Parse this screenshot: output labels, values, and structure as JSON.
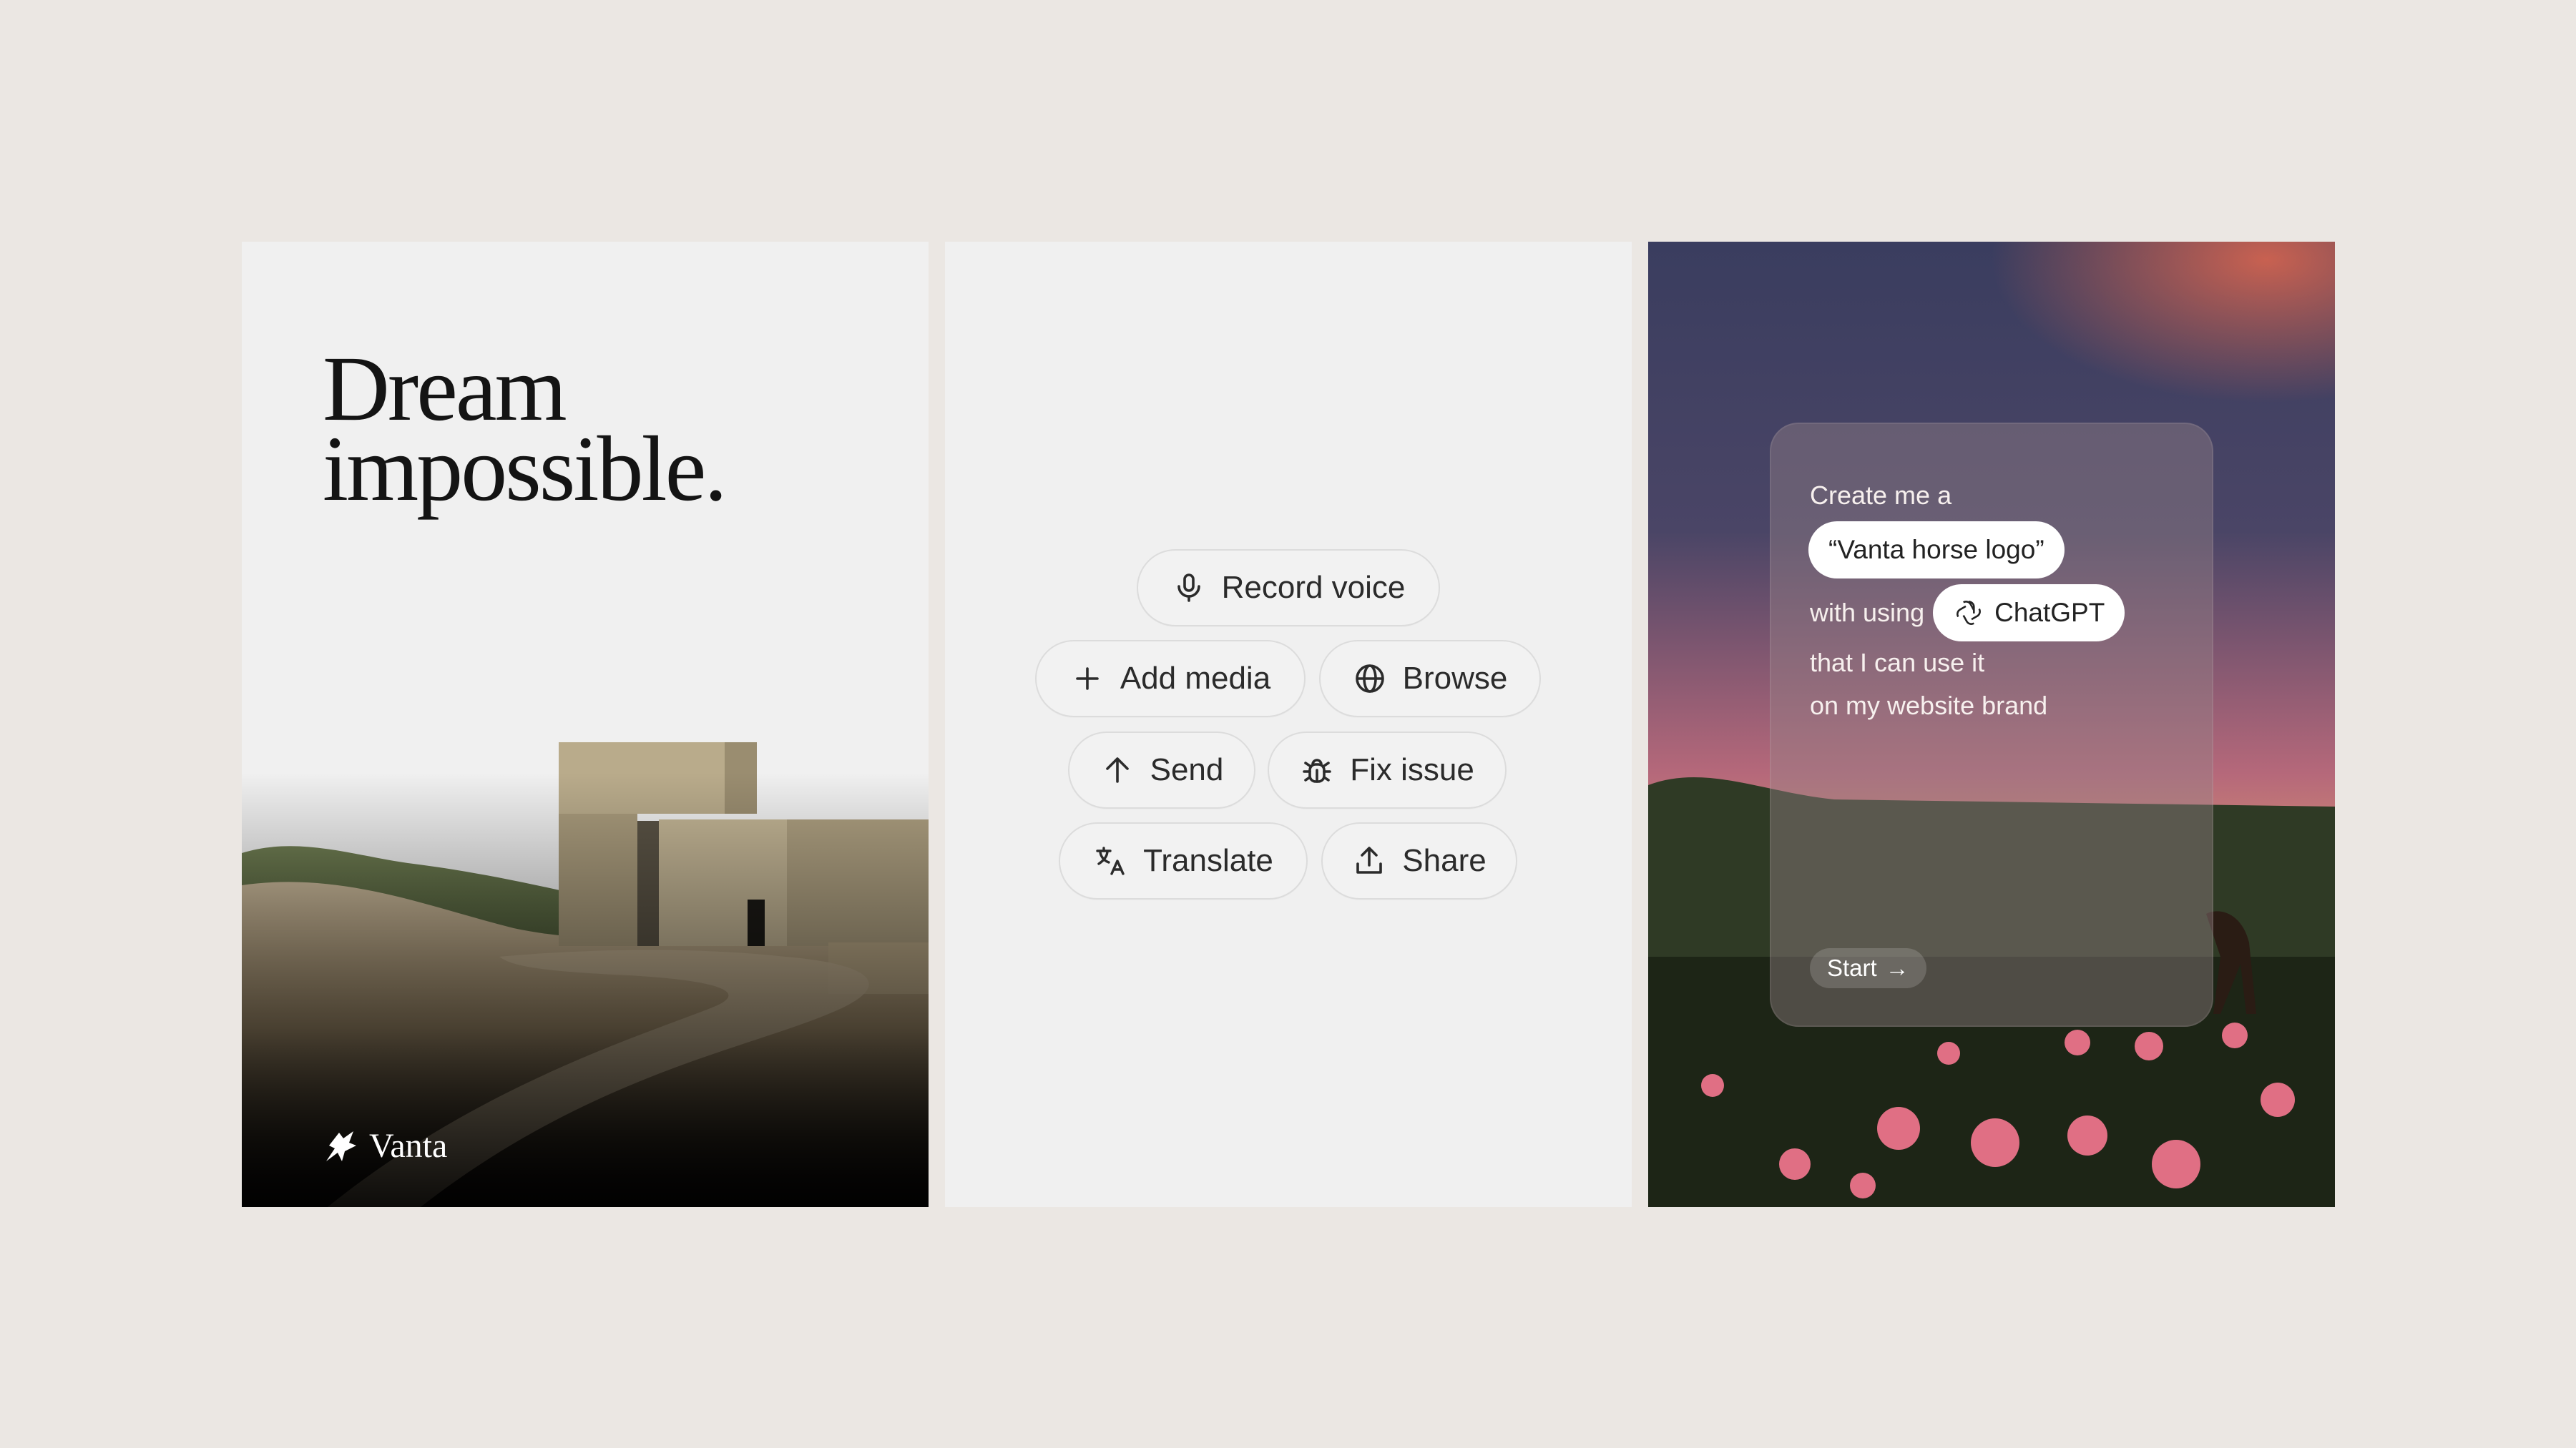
{
  "poster": {
    "headline": "Dream\nimpossible.",
    "brand_name": "Vanta"
  },
  "actions": [
    {
      "label": "Record voice",
      "icon": "microphone-icon"
    },
    {
      "label": "Add media",
      "icon": "plus-icon"
    },
    {
      "label": "Browse",
      "icon": "globe-icon"
    },
    {
      "label": "Send",
      "icon": "arrow-up-icon"
    },
    {
      "label": "Fix issue",
      "icon": "bug-icon"
    },
    {
      "label": "Translate",
      "icon": "translate-icon"
    },
    {
      "label": "Share",
      "icon": "share-icon"
    }
  ],
  "prompt_card": {
    "line1": "Create me a",
    "subject": "“Vanta horse logo”",
    "line2": "with using",
    "tool": "ChatGPT",
    "line3": "that I can use it",
    "line4": "on my website brand",
    "start_label": "Start"
  },
  "colors": {
    "page_bg": "#ebe7e3",
    "card_bg": "#f0f0f0",
    "chip_border": "#dcdcdc",
    "text_dark": "#141414"
  }
}
